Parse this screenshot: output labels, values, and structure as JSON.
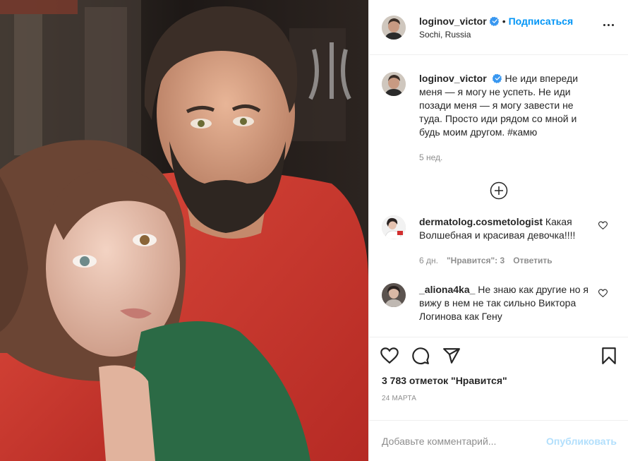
{
  "post": {
    "author": "loginov_victor",
    "location": "Sochi, Russia",
    "follow_label": "Подписаться",
    "separator": "•",
    "icons": {
      "verified": "verified-badge-icon",
      "more": "more-options-icon",
      "like": "heart-icon",
      "comment": "comment-icon",
      "share": "share-icon",
      "save": "bookmark-icon",
      "load_more": "plus-circle-icon"
    },
    "accent_color": "#0095f6"
  },
  "caption": {
    "username": "loginov_victor",
    "text": "Не иди впереди меня — я могу не успеть. Не иди позади меня — я могу завести не туда. Просто иди рядом со мной и будь моим другом. #камю",
    "time": "5 нед."
  },
  "comments": [
    {
      "username": "dermatolog.cosmetologist",
      "text": "Какая Волшебная и красивая девочка!!!!",
      "time": "6 дн.",
      "likes": "\"Нравится\": 3",
      "reply": "Ответить"
    },
    {
      "username": "_aliona4ka_",
      "text": "Не знаю как другие но я вижу в нем не так сильно Виктора Логинова как Гену",
      "time": "",
      "likes": "",
      "reply": ""
    }
  ],
  "stats": {
    "likes": "3 783 отметок \"Нравится\"",
    "date": "24 МАРТА"
  },
  "composer": {
    "placeholder": "Добавьте комментарий...",
    "publish_label": "Опубликовать"
  }
}
